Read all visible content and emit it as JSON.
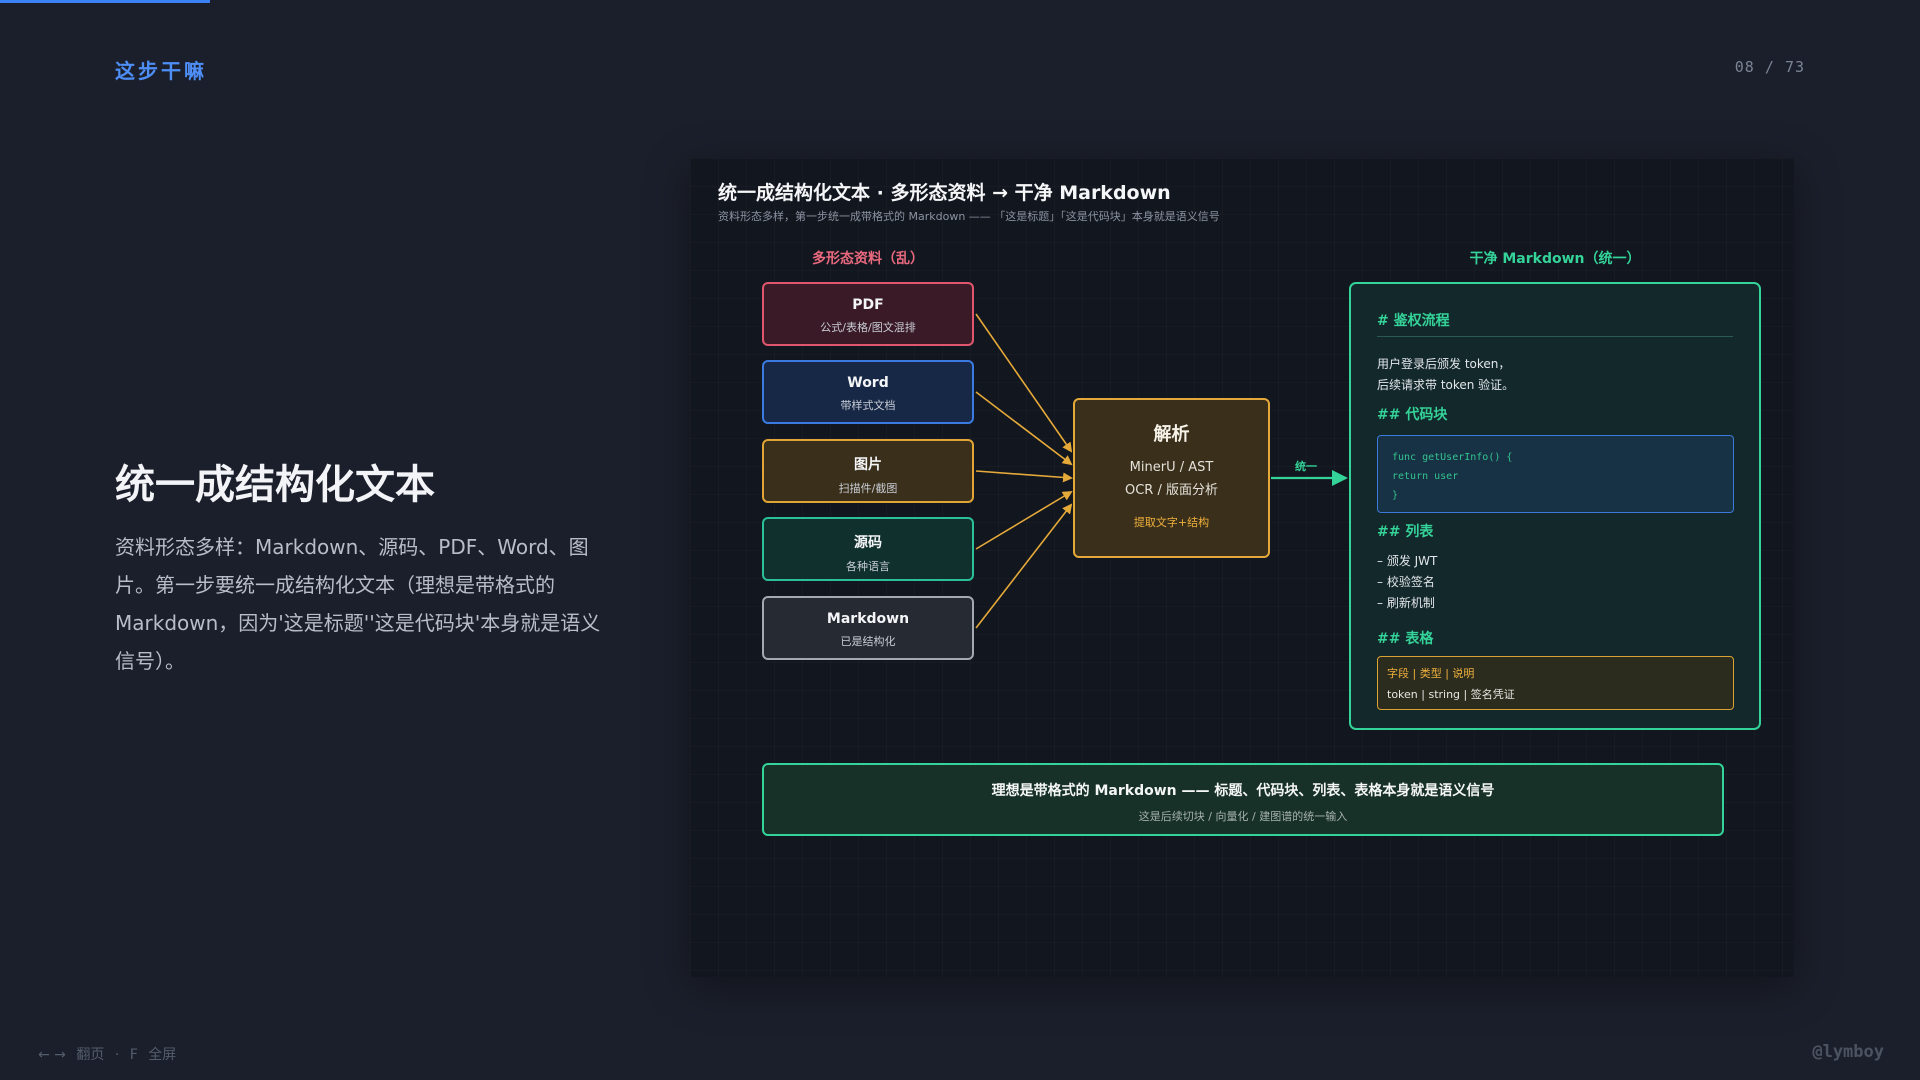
{
  "header": {
    "section_label": "这步干嘛",
    "page_current": "08",
    "page_separator": "/",
    "page_total": "73"
  },
  "slide": {
    "title": "统一成结构化文本",
    "body": "资料形态多样：Markdown、源码、PDF、Word、图片。第一步要统一成结构化文本（理想是带格式的 Markdown，因为'这是标题''这是代码块'本身就是语义信号）。"
  },
  "diagram": {
    "title": "统一成结构化文本 · 多形态资料 → 干净 Markdown",
    "subtitle": "资料形态多样，第一步统一成带格式的 Markdown —— 「这是标题」「这是代码块」本身就是语义信号",
    "left_label": "多形态资料（乱）",
    "right_label": "干净 Markdown（统一）",
    "sources": [
      {
        "name": "PDF",
        "desc": "公式/表格/图文混排",
        "border": "#e0566f",
        "fill": "#3a1a26"
      },
      {
        "name": "Word",
        "desc": "带样式文档",
        "border": "#3b7ae0",
        "fill": "#172846"
      },
      {
        "name": "图片",
        "desc": "扫描件/截图",
        "border": "#e0a534",
        "fill": "#3a2f1a"
      },
      {
        "name": "源码",
        "desc": "各种语言",
        "border": "#2bbf9a",
        "fill": "#10302d"
      },
      {
        "name": "Markdown",
        "desc": "已是结构化",
        "border": "#a3a8b3",
        "fill": "#262a33"
      }
    ],
    "parser": {
      "title": "解析",
      "line1": "MinerU / AST",
      "line2": "OCR / 版面分析",
      "accent": "提取文字+结构"
    },
    "arrow_label": "统一",
    "markdown": {
      "h1": "# 鉴权流程",
      "paragraph": [
        "用户登录后颁发 token，",
        "后续请求带 token 验证。"
      ],
      "h2_code": "## 代码块",
      "code": [
        "func getUserInfo() {",
        "return user",
        "}"
      ],
      "h2_list": "## 列表",
      "list": [
        "– 颁发 JWT",
        "– 校验签名",
        "– 刷新机制"
      ],
      "h2_table": "## 表格",
      "table_header": "字段 | 类型 | 说明",
      "table_row": "token | string | 签名凭证"
    },
    "banner": {
      "main": "理想是带格式的 Markdown —— 标题、代码块、列表、表格本身就是语义信号",
      "sub": "这是后续切块 / 向量化 / 建图谱的统一输入"
    },
    "colors": {
      "connector": "#e5a93a",
      "unify_arrow": "#34d399"
    }
  },
  "footer": {
    "nav_arrows": "← →",
    "nav_label": "翻页",
    "dot": "·",
    "fullscreen_key": "F",
    "fullscreen_label": "全屏",
    "author": "@lymboy"
  }
}
